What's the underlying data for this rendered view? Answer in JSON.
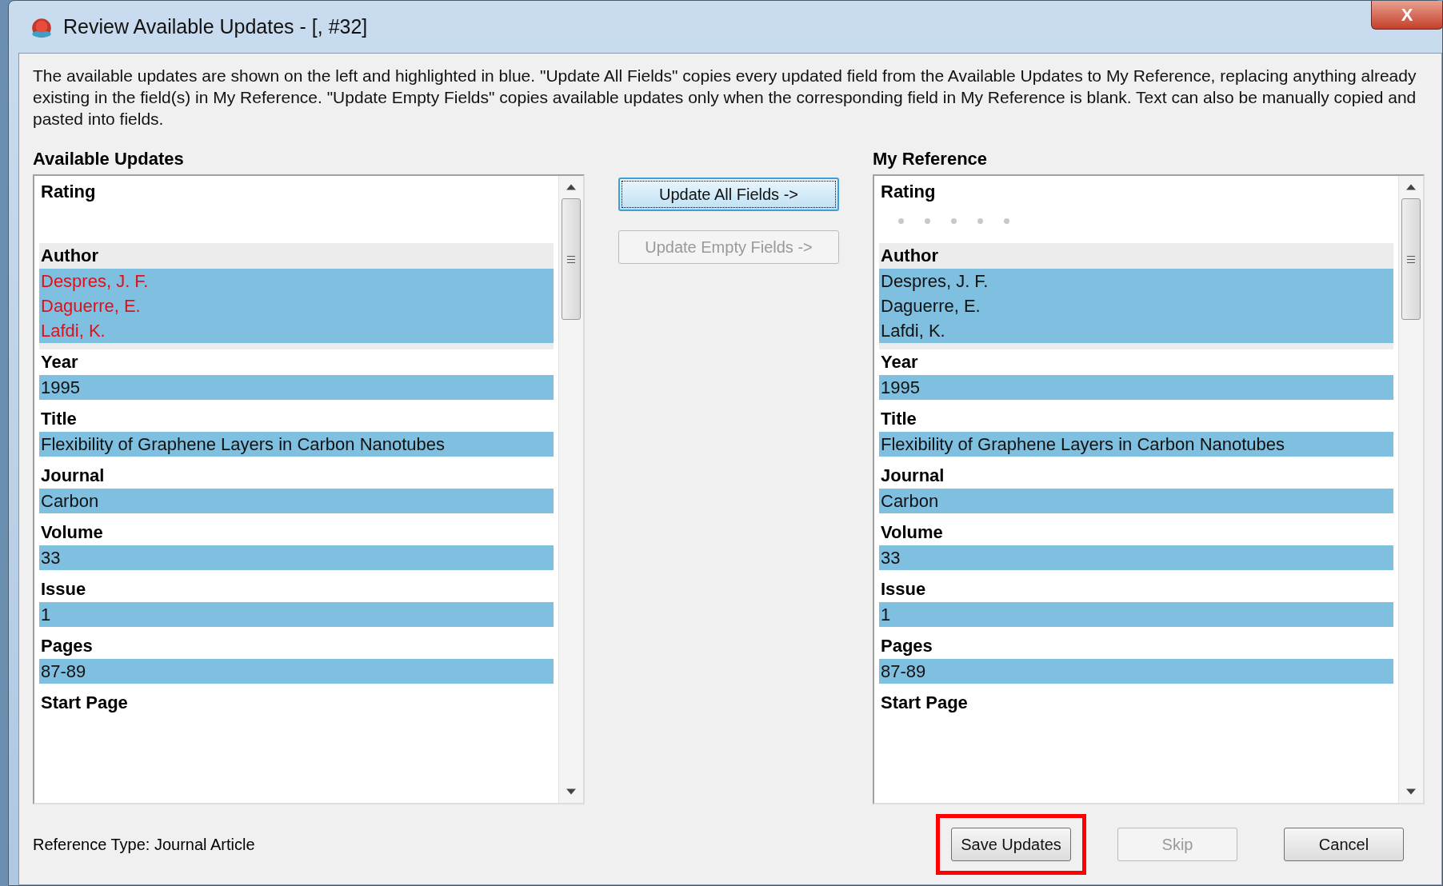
{
  "window": {
    "title": "Review Available Updates - [,  #32]",
    "close": "X"
  },
  "description": "The available updates are shown on the left and highlighted in blue. \"Update All Fields\" copies every updated field from the Available Updates to My Reference, replacing anything already existing in the field(s) in My Reference. \"Update Empty Fields\" copies available updates only when the corresponding field in My Reference is blank. Text can also be manually copied and pasted into fields.",
  "panels": [
    {
      "title": "Available Updates",
      "fields": [
        {
          "label": "Rating",
          "kind": "rating",
          "selected": false
        },
        {
          "label": "Author",
          "kind": "text",
          "selected": true,
          "highlighted": true,
          "changed": true,
          "values": [
            "Despres, J. F.",
            "Daguerre, E.",
            "Lafdi, K."
          ]
        },
        {
          "label": "Year",
          "kind": "text",
          "selected": false,
          "highlighted": true,
          "changed": false,
          "values": [
            "1995"
          ]
        },
        {
          "label": "Title",
          "kind": "text",
          "selected": false,
          "highlighted": true,
          "changed": false,
          "values": [
            "Flexibility of Graphene Layers in Carbon Nanotubes"
          ]
        },
        {
          "label": "Journal",
          "kind": "text",
          "selected": false,
          "highlighted": true,
          "changed": false,
          "values": [
            "Carbon"
          ]
        },
        {
          "label": "Volume",
          "kind": "text",
          "selected": false,
          "highlighted": true,
          "changed": false,
          "values": [
            "33"
          ]
        },
        {
          "label": "Issue",
          "kind": "text",
          "selected": false,
          "highlighted": true,
          "changed": false,
          "values": [
            "1"
          ]
        },
        {
          "label": "Pages",
          "kind": "text",
          "selected": false,
          "highlighted": true,
          "changed": false,
          "values": [
            "87-89"
          ]
        },
        {
          "label": "Start Page",
          "kind": "text",
          "selected": false
        }
      ]
    },
    {
      "title": "My Reference",
      "fields": [
        {
          "label": "Rating",
          "kind": "rating",
          "selected": false,
          "stars": 0
        },
        {
          "label": "Author",
          "kind": "text",
          "selected": true,
          "highlighted": true,
          "changed": false,
          "values": [
            "Despres, J. F.",
            "Daguerre, E.",
            "Lafdi, K."
          ]
        },
        {
          "label": "Year",
          "kind": "text",
          "selected": false,
          "highlighted": true,
          "changed": false,
          "values": [
            "1995"
          ]
        },
        {
          "label": "Title",
          "kind": "text",
          "selected": false,
          "highlighted": true,
          "changed": false,
          "values": [
            "Flexibility of Graphene Layers in Carbon Nanotubes"
          ]
        },
        {
          "label": "Journal",
          "kind": "text",
          "selected": false,
          "highlighted": true,
          "changed": false,
          "values": [
            "Carbon"
          ]
        },
        {
          "label": "Volume",
          "kind": "text",
          "selected": false,
          "highlighted": true,
          "changed": false,
          "values": [
            "33"
          ]
        },
        {
          "label": "Issue",
          "kind": "text",
          "selected": false,
          "highlighted": true,
          "changed": false,
          "values": [
            "1"
          ]
        },
        {
          "label": "Pages",
          "kind": "text",
          "selected": false,
          "highlighted": true,
          "changed": false,
          "values": [
            "87-89"
          ]
        },
        {
          "label": "Start Page",
          "kind": "text",
          "selected": false
        }
      ]
    }
  ],
  "update_buttons": [
    {
      "label": "Update All Fields ->",
      "disabled": false,
      "focused": true
    },
    {
      "label": "Update Empty Fields ->",
      "disabled": true,
      "focused": false
    }
  ],
  "reference_type": "Reference Type: Journal Article",
  "buttons": [
    {
      "label": "Save Updates",
      "disabled": false,
      "outlined": true
    },
    {
      "label": "Skip",
      "disabled": true,
      "outlined": false
    },
    {
      "label": "Cancel",
      "disabled": false,
      "outlined": false
    }
  ]
}
